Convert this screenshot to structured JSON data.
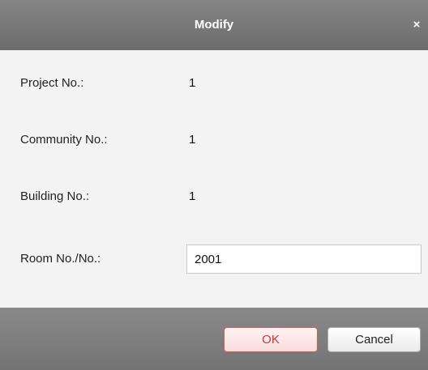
{
  "dialog": {
    "title": "Modify",
    "close_symbol": "×"
  },
  "fields": {
    "project_label": "Project No.:",
    "project_value": "1",
    "community_label": "Community No.:",
    "community_value": "1",
    "building_label": "Building No.:",
    "building_value": "1",
    "room_label": "Room No./No.:",
    "room_value": "2001"
  },
  "buttons": {
    "ok_label": "OK",
    "cancel_label": "Cancel"
  },
  "colors": {
    "titlebar": "#7a7a7a",
    "ok_border": "#d55a5a",
    "ok_text": "#c33b3b"
  }
}
